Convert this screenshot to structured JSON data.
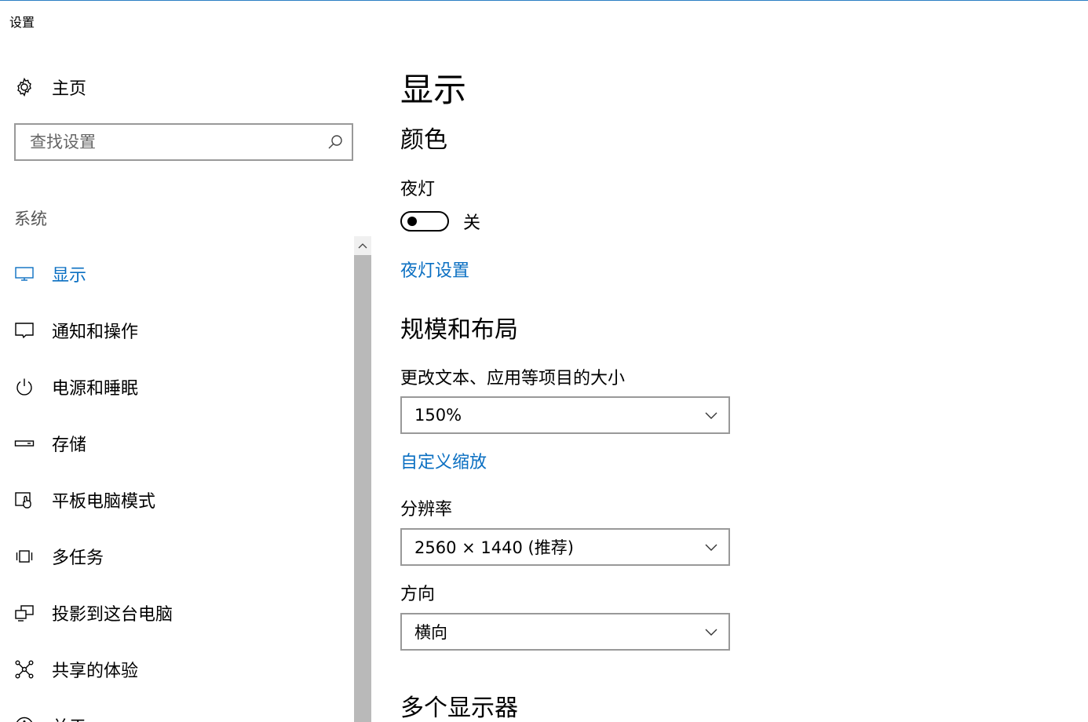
{
  "window": {
    "title": "设置"
  },
  "sidebar": {
    "home_label": "主页",
    "search_placeholder": "查找设置",
    "section": "系统",
    "items": [
      {
        "label": "显示",
        "icon": "monitor-icon",
        "active": true
      },
      {
        "label": "通知和操作",
        "icon": "notification-icon"
      },
      {
        "label": "电源和睡眠",
        "icon": "power-icon"
      },
      {
        "label": "存储",
        "icon": "storage-icon"
      },
      {
        "label": "平板电脑模式",
        "icon": "tablet-mode-icon"
      },
      {
        "label": "多任务",
        "icon": "multitask-icon"
      },
      {
        "label": "投影到这台电脑",
        "icon": "project-icon"
      },
      {
        "label": "共享的体验",
        "icon": "shared-experience-icon"
      },
      {
        "label": "关于",
        "icon": "info-icon"
      }
    ]
  },
  "main": {
    "title": "显示",
    "color_section": "颜色",
    "night_light_label": "夜灯",
    "night_light_state": "关",
    "night_light_settings_link": "夜灯设置",
    "scale_section": "规模和布局",
    "scale_label": "更改文本、应用等项目的大小",
    "scale_value": "150%",
    "custom_scale_link": "自定义缩放",
    "resolution_label": "分辨率",
    "resolution_value": "2560 × 1440 (推荐)",
    "orientation_label": "方向",
    "orientation_value": "横向",
    "multi_display_section": "多个显示器"
  },
  "colors": {
    "accent": "#0a6fc2"
  }
}
